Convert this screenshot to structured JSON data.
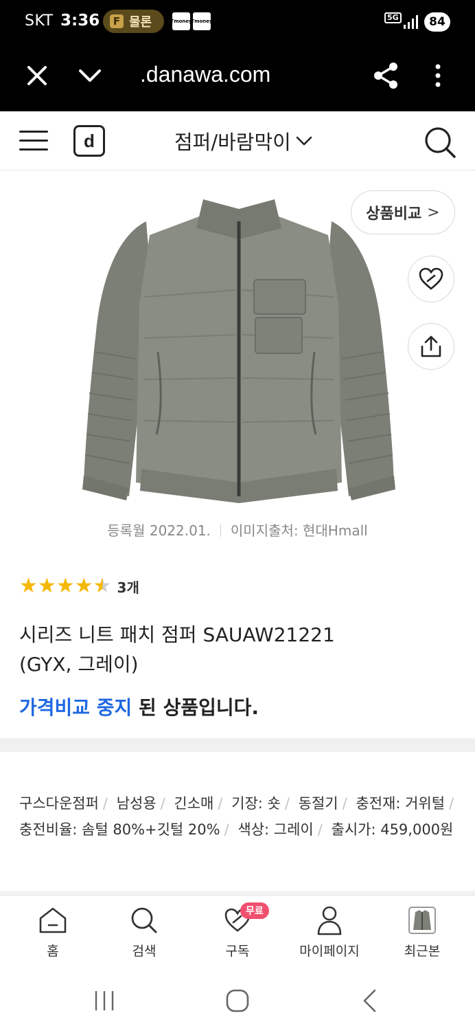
{
  "status_bar": {
    "carrier": "SKT",
    "time": "3:36",
    "pill_icon": "F",
    "pill_text": "물론",
    "tmoney_1": "Tmoney",
    "tmoney_2": "Tmoney",
    "network": "5G",
    "battery": "84"
  },
  "browser": {
    "url": "​.danawa.com",
    "icons": [
      "close-icon",
      "chevron-down-icon",
      "share-icon",
      "more-vertical-icon"
    ]
  },
  "header": {
    "logo": "d",
    "category": "점퍼/바람막이",
    "category_icon": "chevron-down-icon"
  },
  "product": {
    "image_alt": "grey knit patch jumper",
    "compare_label": "상품비교",
    "compare_arrow": ">",
    "registered": "등록월 2022.01.",
    "image_source": "이미지출처: 현대Hmall",
    "rating": 4.5,
    "review_count": "3개",
    "title_line1": "시리즈 니트 패치 점퍼 SAUAW21221",
    "title_line2": "(GYX, 그레이)",
    "notice_blue": "가격비교 중지",
    "notice_rest": " 된 상품입니다."
  },
  "specs": {
    "items": [
      "구스다운점퍼",
      "남성용",
      "긴소매",
      "기장: 숏",
      "동절기",
      "충전재: 거위털",
      "충전비율: 솜털 80%+깃털 20%",
      "색상: 그레이",
      "출시가: 459,000원"
    ]
  },
  "bottom_nav": {
    "items": [
      {
        "label": "홈",
        "icon": "home-icon"
      },
      {
        "label": "검색",
        "icon": "search-icon"
      },
      {
        "label": "구독",
        "icon": "heart-icon",
        "badge": "무료"
      },
      {
        "label": "마이페이지",
        "icon": "user-icon"
      },
      {
        "label": "최근본",
        "icon": "recent-product-thumbnail"
      }
    ]
  },
  "colors": {
    "accent_blue": "#1f68e2",
    "star": "#f5b800",
    "badge_pink": "#f0506e"
  }
}
